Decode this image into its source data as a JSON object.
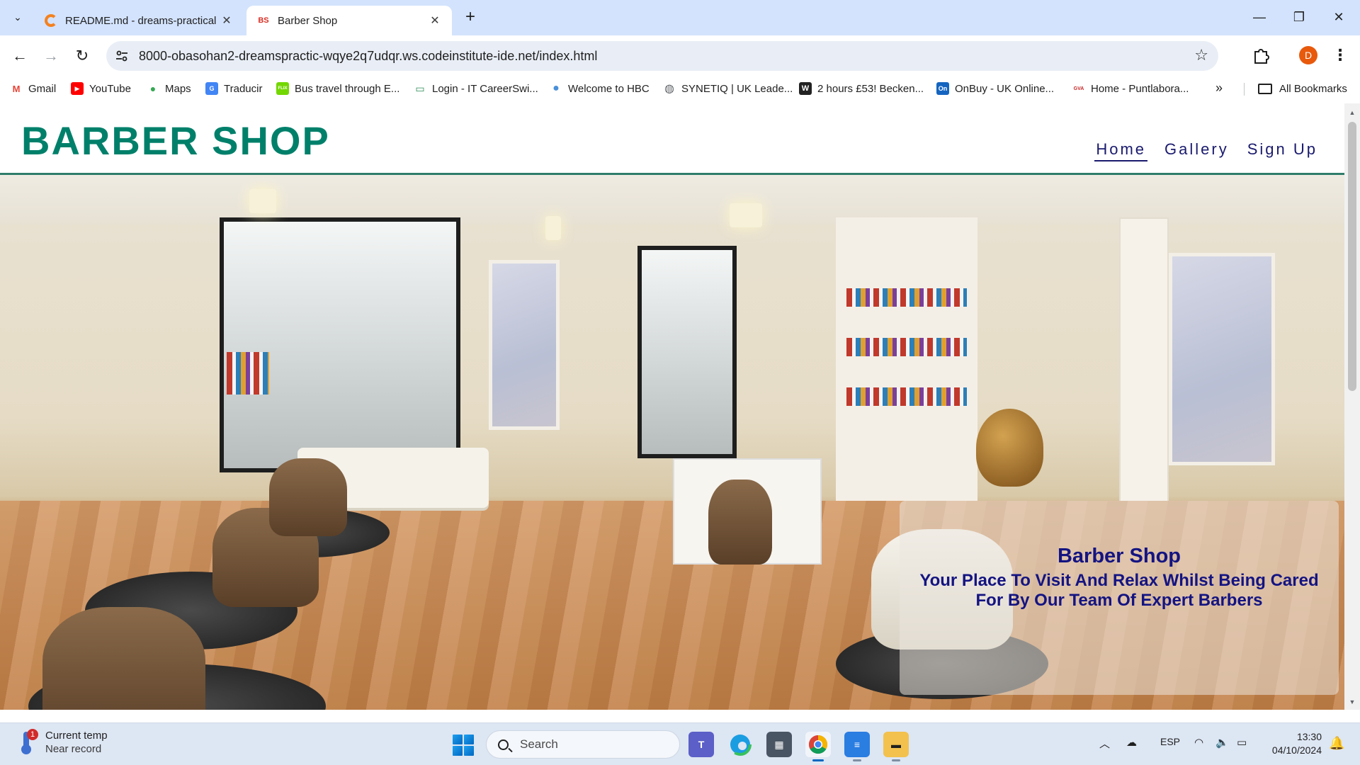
{
  "browser": {
    "tabs": [
      {
        "title": "README.md - dreams-practical",
        "favicon": "gitpod-icon",
        "active": false
      },
      {
        "title": "Barber Shop",
        "favicon": "bs-favicon",
        "favicon_text": "BS",
        "active": true
      }
    ],
    "url": "8000-obasohan2-dreamspractic-wqye2q7udqr.ws.codeinstitute-ide.net/index.html",
    "profile_initial": "D",
    "bookmarks": [
      {
        "label": "Gmail",
        "icon": "gmail-icon",
        "color": "#ea4335",
        "glyph": "M"
      },
      {
        "label": "YouTube",
        "icon": "youtube-icon",
        "color": "#ff0000",
        "glyph": "▶"
      },
      {
        "label": "Maps",
        "icon": "maps-icon",
        "color": "#34a853",
        "glyph": "●"
      },
      {
        "label": "Traducir",
        "icon": "translate-icon",
        "color": "#4285f4",
        "glyph": "G"
      },
      {
        "label": "Bus travel through E...",
        "icon": "flixbus-icon",
        "color": "#73d700",
        "glyph": "FLIX"
      },
      {
        "label": "Login - IT CareerSwi...",
        "icon": "careerswitch-icon",
        "color": "#2e8b57",
        "glyph": "▭"
      },
      {
        "label": "Welcome to HBC",
        "icon": "hbc-icon",
        "color": "#4a90d9",
        "glyph": "●"
      },
      {
        "label": "SYNETIQ | UK Leade...",
        "icon": "globe-icon",
        "color": "#5f6368",
        "glyph": "◍"
      },
      {
        "label": "2 hours £53! Becken...",
        "icon": "news-icon",
        "color": "#222222",
        "glyph": "W"
      },
      {
        "label": "OnBuy - UK Online...",
        "icon": "onbuy-icon",
        "color": "#1565c0",
        "glyph": "On"
      },
      {
        "label": "Home - Puntlabora...",
        "icon": "gva-icon",
        "color": "#c62828",
        "glyph": "GVA"
      }
    ],
    "all_bookmarks_label": "All Bookmarks",
    "more_glyph": "»"
  },
  "site": {
    "logo": "BARBER SHOP",
    "nav": [
      {
        "label": "Home",
        "current": true
      },
      {
        "label": "Gallery",
        "current": false
      },
      {
        "label": "Sign Up",
        "current": false
      }
    ],
    "hero": {
      "title": "Barber Shop",
      "subtitle": "Your Place To Visit And Relax Whilst Being Cared For By Our Team Of Expert Barbers"
    },
    "colors": {
      "brand": "#00806a",
      "nav_text": "#1a1a6e",
      "hero_text": "#141482"
    }
  },
  "taskbar": {
    "weather_title": "Current temp",
    "weather_sub": "Near record",
    "weather_badge": "1",
    "search_placeholder": "Search",
    "language": "ESP",
    "time": "13:30",
    "date": "04/10/2024"
  }
}
